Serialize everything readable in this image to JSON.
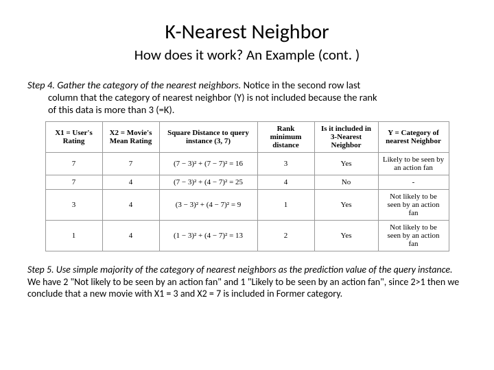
{
  "title": "K-Nearest Neighbor",
  "subtitle": "How does it work? An Example (cont. )",
  "step4": {
    "label": "Step 4.",
    "lead": " Gather the category of the nearest neighbors.",
    "rest1": " Notice in the second row last",
    "rest2": "column that the category of nearest neighbor (Y) is not included because the rank",
    "rest3": "of this data is more than 3 (=K)."
  },
  "headers": {
    "x1": "X1 = User's Rating",
    "x2": "X2 = Movie's Mean Rating",
    "sq": "Square Distance to query instance (3, 7)",
    "rank": "Rank minimum distance",
    "inc": "Is it included in 3-Nearest Neighbor",
    "y": "Y = Category of nearest Neighbor"
  },
  "rows": [
    {
      "x1": "7",
      "x2": "7",
      "sq": "(7 − 3)² + (7 − 7)² = 16",
      "rank": "3",
      "inc": "Yes",
      "y": "Likely to be seen by an action fan"
    },
    {
      "x1": "7",
      "x2": "4",
      "sq": "(7 − 3)² + (4 − 7)² = 25",
      "rank": "4",
      "inc": "No",
      "y": "-"
    },
    {
      "x1": "3",
      "x2": "4",
      "sq": "(3 − 3)² + (4 − 7)² = 9",
      "rank": "1",
      "inc": "Yes",
      "y": "Not likely to be seen by an action fan"
    },
    {
      "x1": "1",
      "x2": "4",
      "sq": "(1 − 3)² + (4 − 7)² = 13",
      "rank": "2",
      "inc": "Yes",
      "y": "Not likely to be seen by an action fan"
    }
  ],
  "step5": {
    "label": "Step 5.",
    "lead": " Use simple majority of the category of nearest neighbors as the prediction value of the query instance.",
    "rest": " We have 2 \"Not likely to be seen by an action fan\" and 1 \"Likely to be seen by an action fan\", since 2>1 then we conclude that a new movie with X1 = 3 and X2 = 7 is included in Former category."
  }
}
